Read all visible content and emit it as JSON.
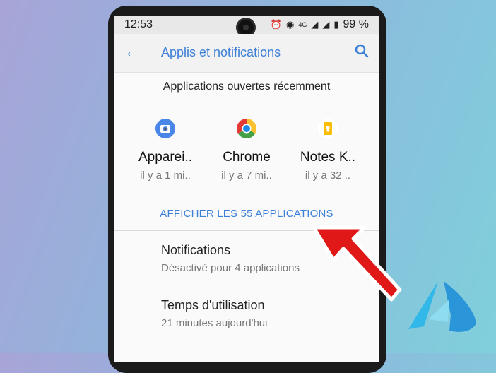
{
  "status_bar": {
    "time": "12:53",
    "battery": "99 %"
  },
  "app_bar": {
    "title": "Applis et notifications"
  },
  "recent": {
    "title": "Applications ouvertes récemment",
    "apps": [
      {
        "name": "Apparei..",
        "time": "il y a 1 mi..",
        "icon": "camera-app-icon"
      },
      {
        "name": "Chrome",
        "time": "il y a 7 mi..",
        "icon": "chrome-icon"
      },
      {
        "name": "Notes K..",
        "time": "il y a 32 ..",
        "icon": "keep-notes-icon"
      }
    ],
    "show_all": "AFFICHER LES 55 APPLICATIONS"
  },
  "settings": [
    {
      "title": "Notifications",
      "subtitle": "Désactivé pour 4 applications"
    },
    {
      "title": "Temps d'utilisation",
      "subtitle": "21 minutes aujourd'hui"
    }
  ],
  "colors": {
    "accent": "#3c7fd8",
    "arrow": "#e01818"
  }
}
